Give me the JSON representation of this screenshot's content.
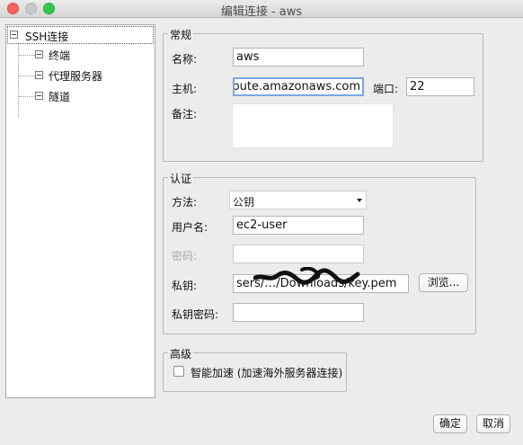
{
  "window": {
    "title": "编辑连接 - aws"
  },
  "sidebar": {
    "root": {
      "label": "SSH连接"
    },
    "items": [
      {
        "label": "终端"
      },
      {
        "label": "代理服务器"
      },
      {
        "label": "隧道"
      }
    ]
  },
  "general": {
    "legend": "常规",
    "name_label": "名称:",
    "name_value": "aws",
    "host_label": "主机:",
    "host_value": "mpute.amazonaws.com",
    "port_label": "端口:",
    "port_value": "22",
    "notes_label": "备注:"
  },
  "auth": {
    "legend": "认证",
    "method_label": "方法:",
    "method_value": "公钥",
    "username_label": "用户名:",
    "username_value": "ec2-user",
    "password_label": "密码:",
    "privkey_label": "私钥:",
    "privkey_value": "sers/…/Downloads/key.pem",
    "browse_label": "浏览...",
    "privkey_pass_label": "私钥密码:"
  },
  "advanced": {
    "legend": "高级",
    "accel_label": "智能加速 (加速海外服务器连接)"
  },
  "footer": {
    "ok_label": "确定",
    "cancel_label": "取消"
  },
  "colors": {
    "close": "#fc615d",
    "minimize": "#c8c8c8",
    "maximize": "#34c84a"
  }
}
